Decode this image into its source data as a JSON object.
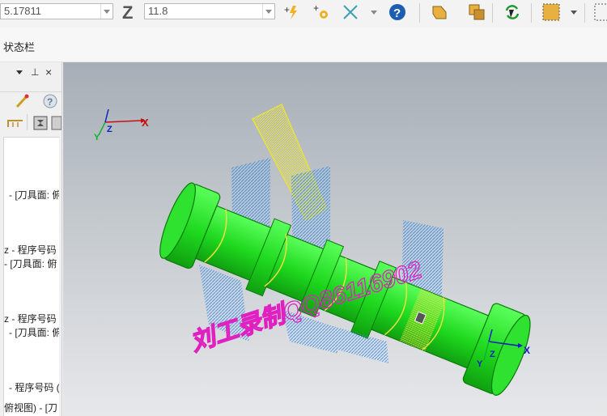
{
  "toolbar": {
    "coord_value": "5.17811",
    "z_label": "Z",
    "z_value": "11.8"
  },
  "status_label": "状态栏",
  "tree_items": [
    "- [刀具面: 俯",
    "z - 程序号码",
    "- [刀具面: 俯",
    "z - 程序号码",
    "- [刀具面: 俯",
    "- 程序号码 (",
    "俯视图) - [刀"
  ],
  "viewport": {
    "axis_x": "X",
    "axis_y": "Y",
    "axis_z": "Z",
    "watermark": "刘工录制QQ86116902"
  },
  "colors": {
    "part_green": "#1ed81e",
    "toolpath_yellow": "#e8e040",
    "toolpath_blue": "#3a8ee8",
    "watermark_magenta": "#e020c0"
  }
}
